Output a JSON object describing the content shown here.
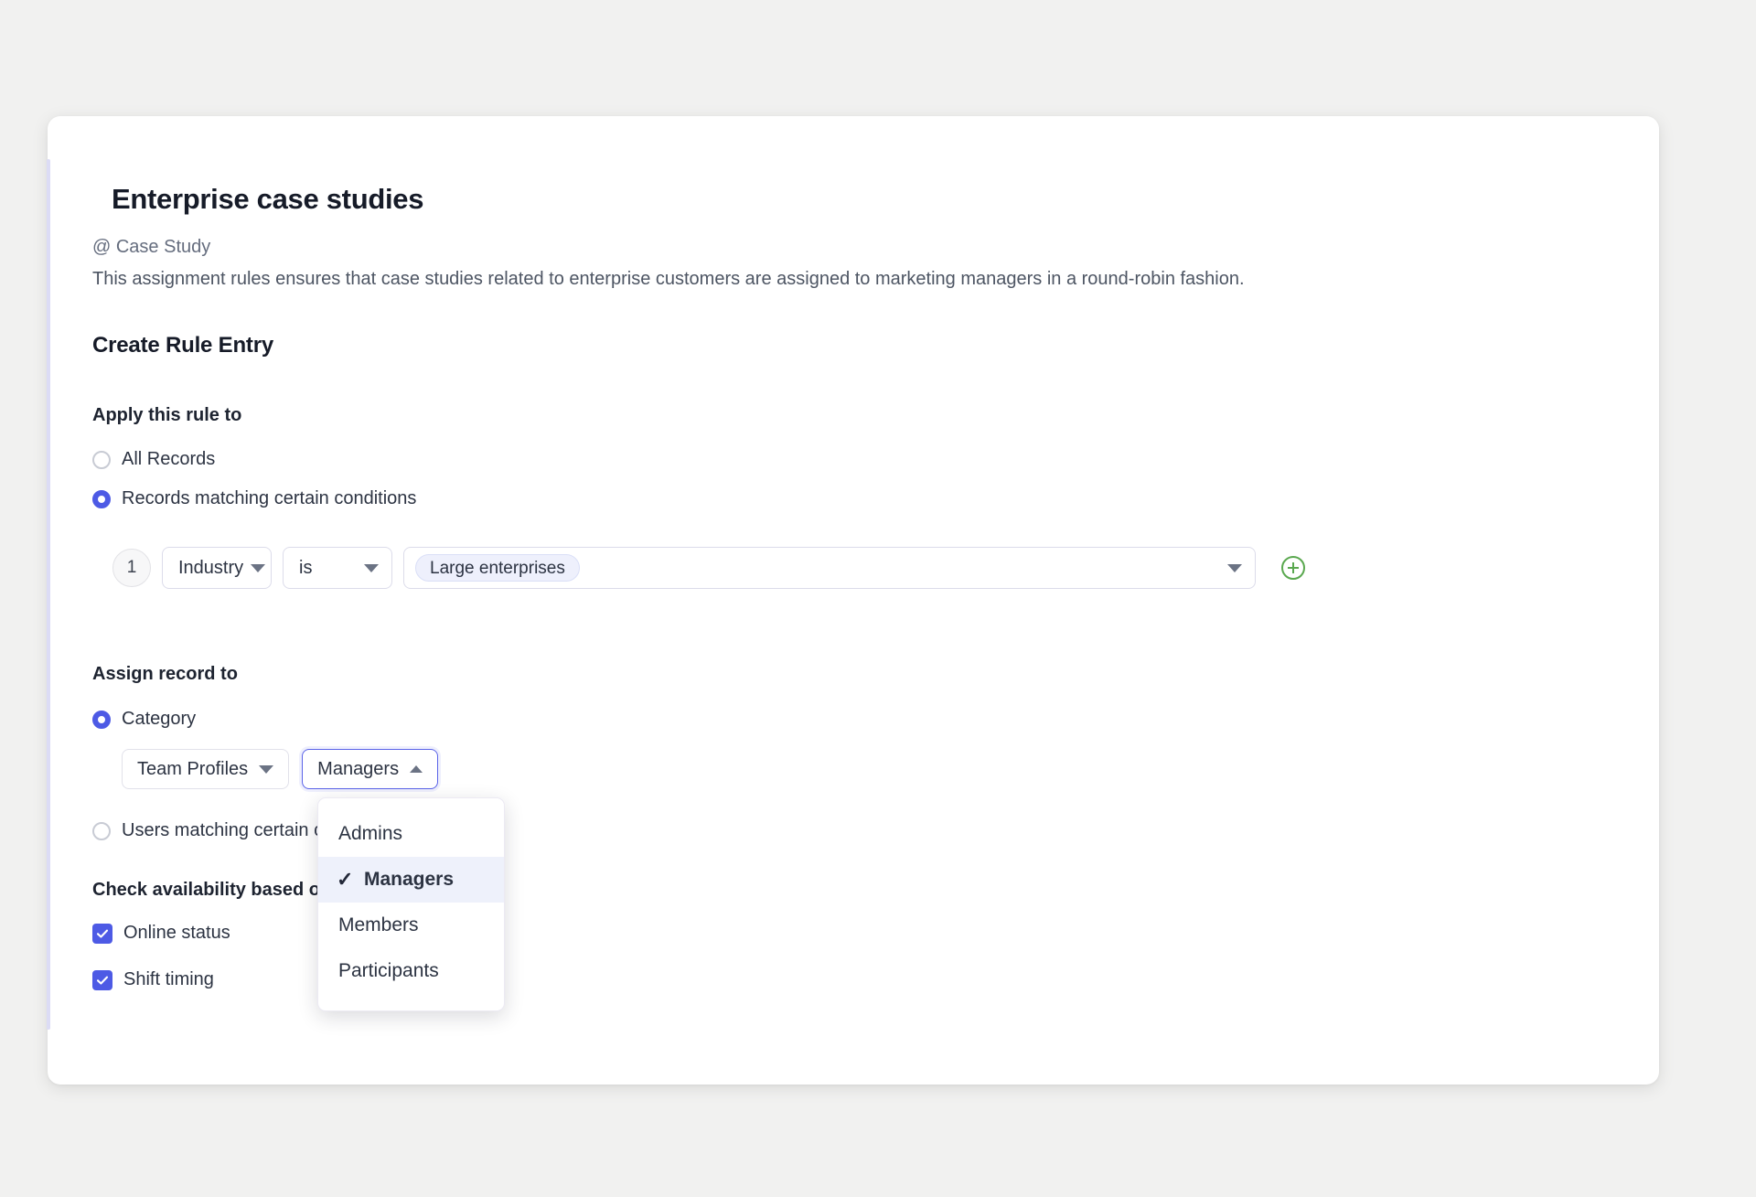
{
  "header": {
    "title": "Enterprise case studies",
    "subtitle": "@ Case Study",
    "description": "This assignment rules ensures that case studies related to enterprise customers are assigned to marketing managers in a round-robin fashion."
  },
  "form": {
    "section_title": "Create Rule Entry",
    "apply_label": "Apply this rule to",
    "apply_options": [
      {
        "label": "All Records",
        "selected": false
      },
      {
        "label": "Records matching certain conditions",
        "selected": true
      }
    ],
    "condition": {
      "index": "1",
      "field": "Industry",
      "operator": "is",
      "values": [
        "Large enterprises"
      ],
      "add_icon": "plus-circle-icon"
    },
    "assign_label": "Assign record to",
    "assign_options": [
      {
        "label": "Category",
        "selected": true
      },
      {
        "label": "Users matching certain conditions",
        "selected": false
      }
    ],
    "assign_selects": {
      "source": "Team Profiles",
      "group": "Managers"
    },
    "dropdown": {
      "open": true,
      "items": [
        {
          "label": "Admins",
          "selected": false
        },
        {
          "label": "Managers",
          "selected": true
        },
        {
          "label": "Members",
          "selected": false
        },
        {
          "label": "Participants",
          "selected": false
        }
      ],
      "check_glyph": "✓"
    },
    "availability_label": "Check availability based on",
    "availability_options": [
      {
        "label": "Online status",
        "checked": true
      },
      {
        "label": "Shift timing",
        "checked": true
      }
    ]
  },
  "colors": {
    "accent": "#4d5ae5",
    "add_button": "#5aa84f",
    "chip_bg": "#eef0fc",
    "menu_highlight": "#eef1fb",
    "page_bg": "#f1f1f0"
  }
}
